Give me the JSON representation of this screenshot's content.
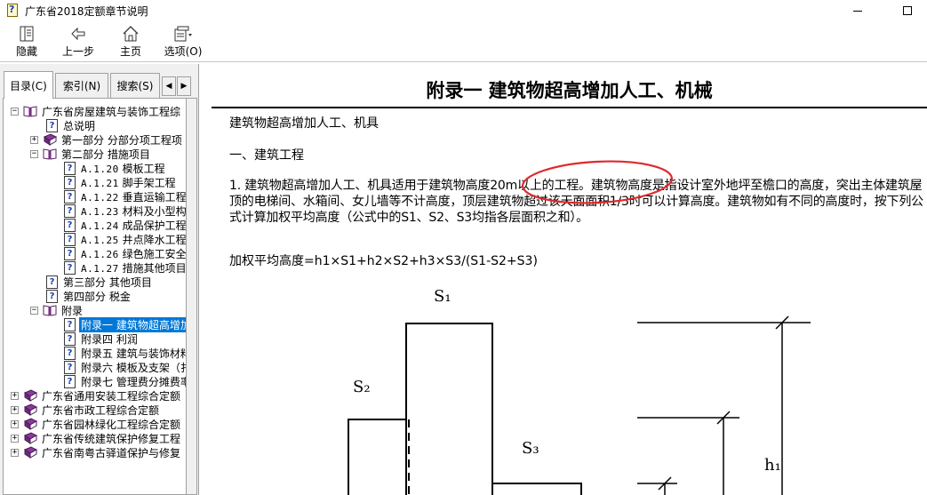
{
  "window": {
    "title": "广东省2018定额章节说明"
  },
  "toolbar": {
    "hide": "隐藏",
    "back": "上一步",
    "home": "主页",
    "options": "选项(O)"
  },
  "tabs": {
    "contents": "目录(C)",
    "index": "索引(N)",
    "search": "搜索(S)"
  },
  "tree": {
    "n1": "广东省房屋建筑与装饰工程综",
    "n2": "总说明",
    "n3": "第一部分 分部分项工程项",
    "n4": "第二部分 措施项目",
    "n5_code": "A.1.20",
    "n5": "模板工程",
    "n6_code": "A.1.21",
    "n6": "脚手架工程",
    "n7_code": "A.1.22",
    "n7": "垂直运输工程",
    "n8_code": "A.1.23",
    "n8": "材料及小型构件",
    "n9_code": "A.1.24",
    "n9": "成品保护工程",
    "n10_code": "A.1.25",
    "n10": "井点降水工程",
    "n11_code": "A.1.26",
    "n11": "绿色施工安全防",
    "n12_code": "A.1.27",
    "n12": "措施其他项目",
    "n13": "第三部分 其他项目",
    "n14": "第四部分 税金",
    "n15": "附录",
    "n16": "附录一 建筑物超高增加",
    "n17": "附录四 利润",
    "n18": "附录五 建筑与装饰材料",
    "n19": "附录六 模板及支架（扌",
    "n20": "附录七 管理费分摊费率",
    "n21": "广东省通用安装工程综合定额",
    "n22": "广东省市政工程综合定额",
    "n23": "广东省园林绿化工程综合定额",
    "n24": "广东省传统建筑保护修复工程",
    "n25": "广东省南粤古驿道保护与修复"
  },
  "doc": {
    "title": "附录一  建筑物超高增加人工、机械",
    "subtitle": "建筑物超高增加人工、机具",
    "section": "一、建筑工程",
    "para1": "1. 建筑物超高增加人工、机具适用于建筑物高度20m以上的工程。建筑物高度是指设计室外地坪至檐口的高度，突出主体建筑屋顶的电梯间、水箱间、女儿墙等不计高度，顶层建筑物超过该天面面积1/3时可以计算高度。建筑物如有不同的高度时，按下列公式计算加权平均高度（公式中的S1、S2、S3均指各层面积之和）。",
    "formula": "加权平均高度=h1×S1+h2×S2+h3×S3/(S1-S2+S3)",
    "s1": "S₁",
    "s2": "S₂",
    "s3": "S₃",
    "h1": "h₁",
    "annotation_color": "#e0282c"
  }
}
